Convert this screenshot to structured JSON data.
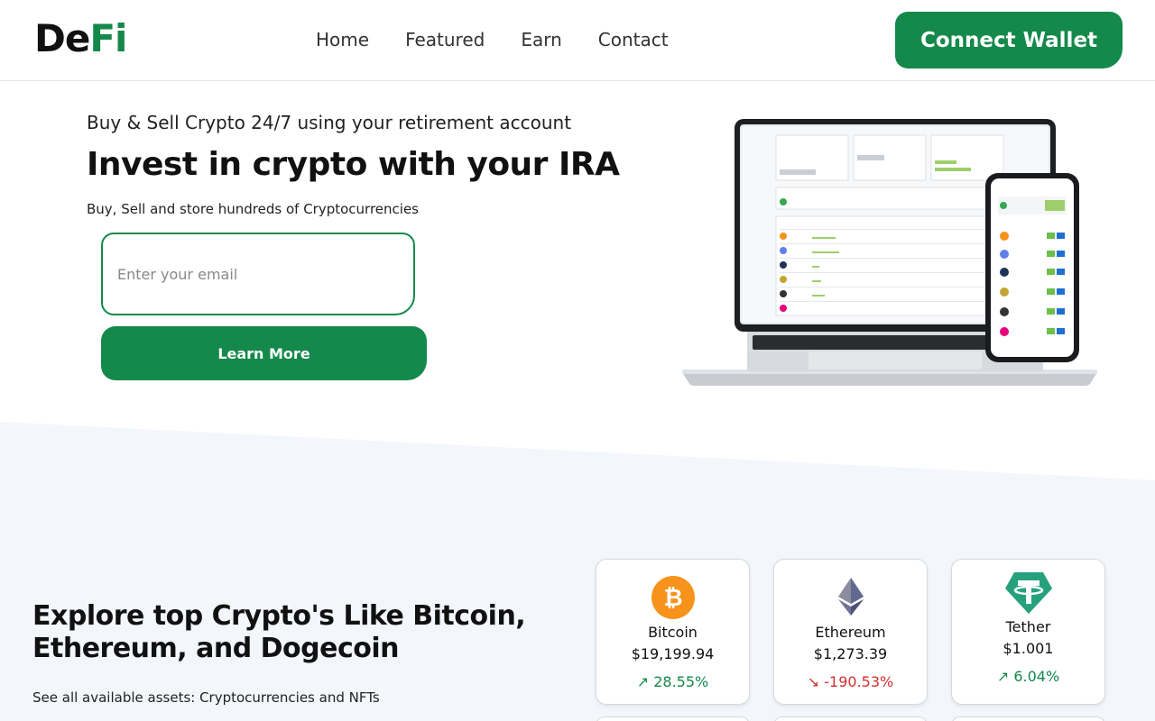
{
  "header": {
    "logo_part1": "De",
    "logo_part2": "Fi",
    "nav": [
      "Home",
      "Featured",
      "Earn",
      "Contact"
    ],
    "connect_label": "Connect Wallet"
  },
  "hero": {
    "kicker": "Buy & Sell Crypto 24/7 using your retirement account",
    "title": "Invest in crypto with your IRA",
    "subtitle": "Buy, Sell and store hundreds of Cryptocurrencies",
    "email_placeholder": "Enter your email",
    "learn_more_label": "Learn More"
  },
  "explore": {
    "title": "Explore top Crypto's Like Bitcoin, Ethereum, and Dogecoin",
    "subtitle": "See all available assets: Cryptocurrencies and NFTs"
  },
  "coins": [
    {
      "name": "Bitcoin",
      "price": "$19,199.94",
      "change": "28.55%",
      "direction": "up",
      "icon": "bitcoin-icon",
      "color": "#f7931a"
    },
    {
      "name": "Ethereum",
      "price": "$1,273.39",
      "change": "-190.53%",
      "direction": "down",
      "icon": "ethereum-icon",
      "color": "#627eea"
    },
    {
      "name": "Tether",
      "price": "$1.001",
      "change": "6.04%",
      "direction": "up",
      "icon": "tether-icon",
      "color": "#26a17b"
    }
  ],
  "colors": {
    "brand": "#14894b",
    "negative": "#d32f2f",
    "band": "#f3f6fb"
  }
}
